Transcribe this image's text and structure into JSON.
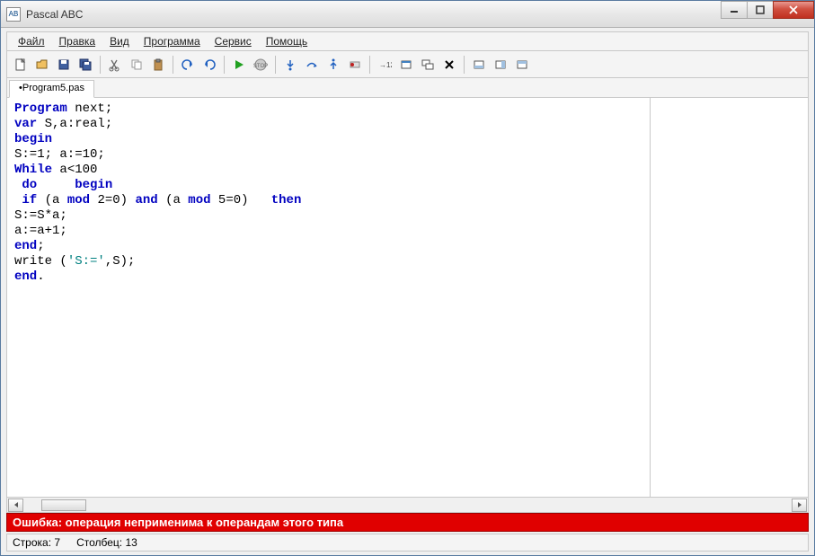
{
  "window": {
    "title": "Pascal ABC",
    "app_icon_text": "AB"
  },
  "menu": {
    "file": "Файл",
    "edit": "Правка",
    "view": "Вид",
    "program": "Программа",
    "service": "Сервис",
    "help": "Помощь"
  },
  "tab": {
    "label": "•Program5.pas"
  },
  "code": {
    "l1a": "Program",
    "l1b": " next;",
    "l2a": "var",
    "l2b": " S,a:real;",
    "l3": "begin",
    "l4": "S:=1; a:=10;",
    "l5a": "While",
    "l5b": " a<100",
    "l6a": " do",
    "l6b": "     begin",
    "l7a": " if",
    "l7b": " (a ",
    "l7c": "mod",
    "l7d": " 2=0) ",
    "l7e": "and",
    "l7f": " (a ",
    "l7g": "mod",
    "l7h": " 5=0)   ",
    "l7i": "then",
    "l8": "S:=S*a;",
    "l9": "a:=a+1;",
    "l10": "end",
    "l10b": ";",
    "l11a": "write (",
    "l11b": "'S:='",
    "l11c": ",S);",
    "l12": "end",
    "l12b": "."
  },
  "error": {
    "text": "Ошибка: операция неприменима к операндам этого типа"
  },
  "status": {
    "line_label": "Строка:",
    "line_value": "7",
    "col_label": "Столбец:",
    "col_value": "13"
  }
}
